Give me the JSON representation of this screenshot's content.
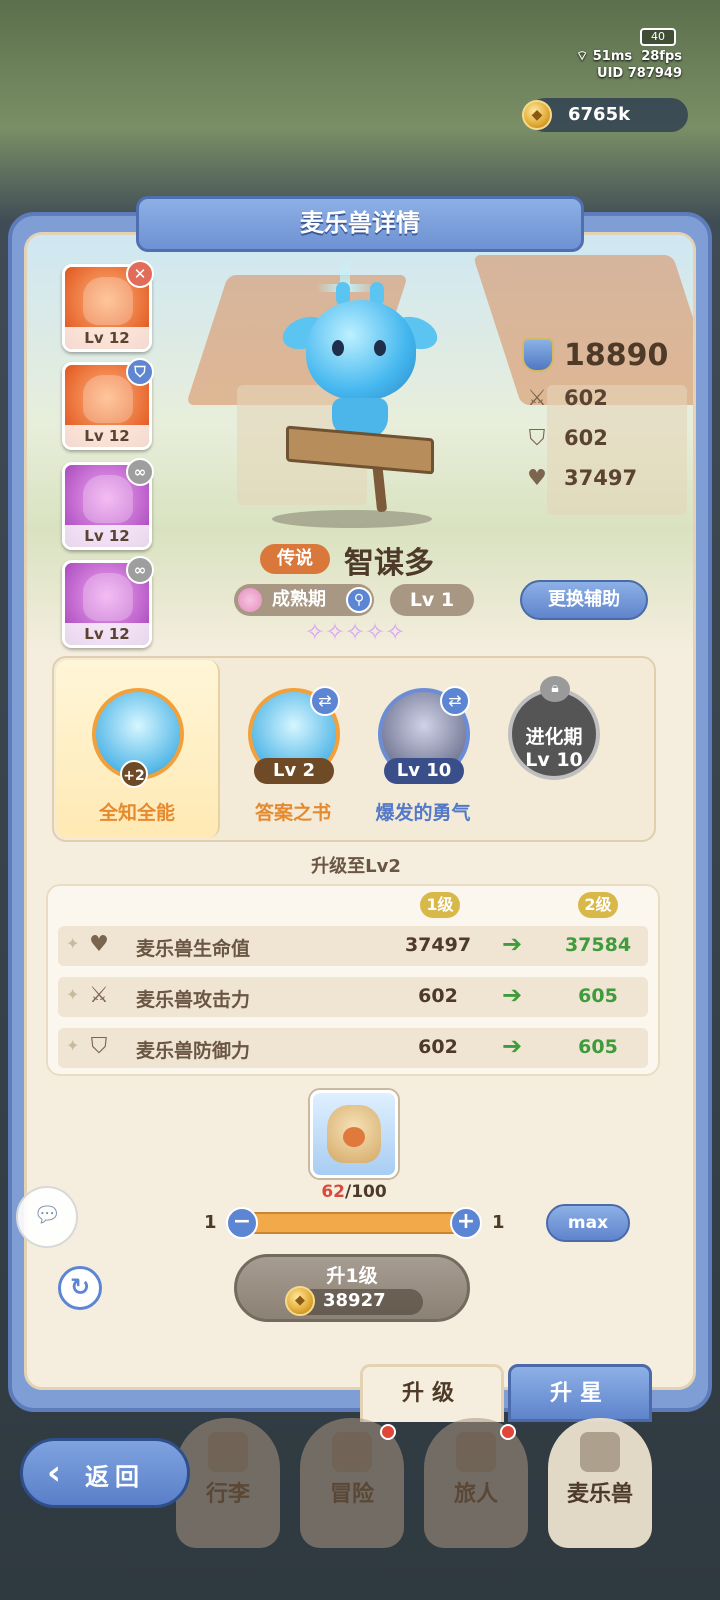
{
  "status": {
    "battery": "40",
    "ping": "51ms",
    "fps": "28fps",
    "uid": "UID 787949"
  },
  "currency": {
    "value": "6765k"
  },
  "panel": {
    "title": "麦乐兽详情"
  },
  "side_pets": [
    {
      "level": "Lv 12",
      "badge": "✕"
    },
    {
      "level": "Lv 12",
      "badge": "⛉"
    },
    {
      "level": "Lv 12",
      "badge": "∞"
    },
    {
      "level": "Lv 12",
      "badge": "∞"
    }
  ],
  "stats": {
    "power": "18890",
    "attack": "602",
    "defense": "602",
    "hp": "37497"
  },
  "pet": {
    "rarity": "传说",
    "name": "智谋多",
    "stage": "成熟期",
    "level": "Lv 1",
    "stars": "✧✧✧✧✧"
  },
  "change_assist": "更换辅助",
  "skills": [
    {
      "name": "全知全能",
      "bonus": "+2"
    },
    {
      "name": "答案之书",
      "level": "Lv 2"
    },
    {
      "name": "爆发的勇气",
      "level": "Lv 10"
    },
    {
      "title": "进化期",
      "level": "Lv 10"
    }
  ],
  "upgrade": {
    "heading": "升级至Lv2",
    "from_label": "1级",
    "to_label": "2级",
    "rows": [
      {
        "label": "麦乐兽生命值",
        "old": "37497",
        "new": "37584"
      },
      {
        "label": "麦乐兽攻击力",
        "old": "602",
        "new": "605"
      },
      {
        "label": "麦乐兽防御力",
        "old": "602",
        "new": "605"
      }
    ],
    "material_have": "62",
    "material_need": "/100",
    "slider_min": "1",
    "slider_max": "1",
    "max_label": "max",
    "button_label": "升1级",
    "cost": "38927"
  },
  "tabs": {
    "upgrade": "升级",
    "star": "升星"
  },
  "nav": {
    "back": "返回",
    "items": [
      "行李",
      "冒险",
      "旅人",
      "麦乐兽"
    ]
  },
  "colors": {
    "panel_blue": "#7f9ed6",
    "panel_bg": "#f5eedf",
    "increase_green": "#3f9b3c",
    "rarity_orange": "#d9783a"
  }
}
